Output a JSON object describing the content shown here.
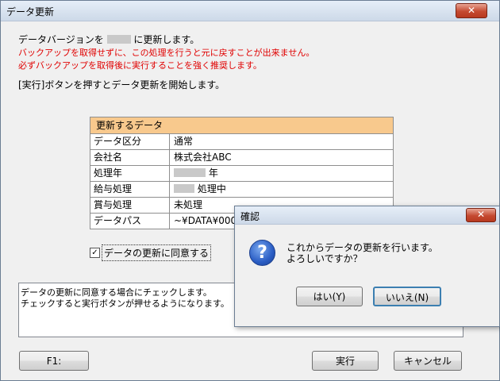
{
  "window": {
    "title": "データ更新",
    "close_glyph": "✕"
  },
  "intro": {
    "line1_prefix": "データバージョンを",
    "line1_suffix": "に更新します。",
    "warning1": "バックアップを取得せずに、この処理を行うと元に戻すことが出来ません。",
    "warning2": "必ずバックアップを取得後に実行することを強く推奨します。",
    "instruction": "[実行]ボタンを押すとデータ更新を開始します。"
  },
  "table": {
    "header": "更新するデータ",
    "rows": [
      {
        "label": "データ区分",
        "value": "通常"
      },
      {
        "label": "会社名",
        "value": "株式会社ABC"
      },
      {
        "label": "処理年",
        "value": "年"
      },
      {
        "label": "給与処理",
        "value": "処理中"
      },
      {
        "label": "賞与処理",
        "value": "未処理"
      },
      {
        "label": "データパス",
        "value": "~¥DATA¥0001"
      }
    ]
  },
  "agree": {
    "checked": true,
    "check_glyph": "✓",
    "label": "データの更新に同意する"
  },
  "description": {
    "line1": "データの更新に同意する場合にチェックします。",
    "line2": "チェックすると実行ボタンが押せるようになります。"
  },
  "buttons": {
    "f1": "F1:",
    "run": "実行",
    "cancel": "キャンセル"
  },
  "dialog": {
    "title": "確認",
    "close_glyph": "✕",
    "icon": "question-icon",
    "icon_glyph": "?",
    "message1": "これからデータの更新を行います。",
    "message2": "よろしいですか？",
    "yes": "はい(Y)",
    "no": "いいえ(N)"
  },
  "colors": {
    "table_header": "#f8c98d",
    "warning": "#e00000",
    "close": "#c54a31"
  }
}
